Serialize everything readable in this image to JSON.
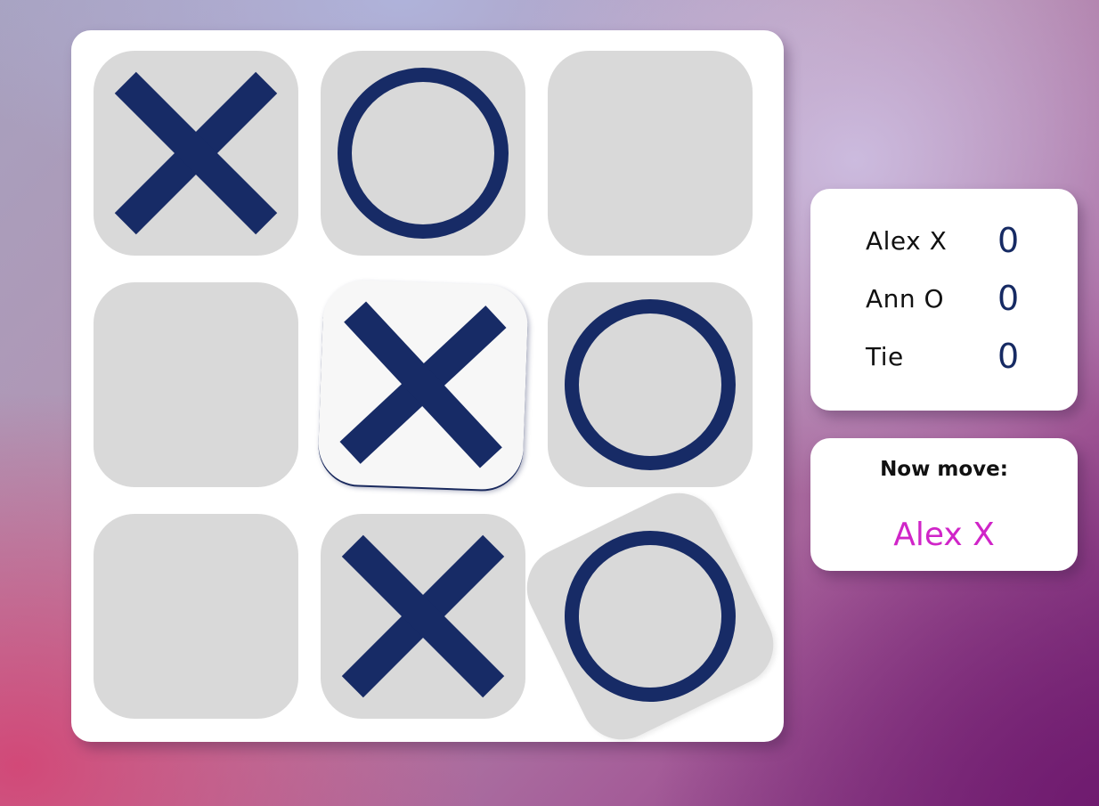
{
  "board": {
    "mark_color": "#172b66",
    "cells": [
      {
        "mark": "X"
      },
      {
        "mark": "O"
      },
      {
        "mark": ""
      },
      {
        "mark": ""
      },
      {
        "mark": "X"
      },
      {
        "mark": "O"
      },
      {
        "mark": ""
      },
      {
        "mark": "X"
      },
      {
        "mark": "O"
      }
    ]
  },
  "scoreboard": {
    "rows": [
      {
        "name": "Alex X",
        "score": "0"
      },
      {
        "name": "Ann O",
        "score": "0"
      },
      {
        "name": "Tie",
        "score": "0"
      }
    ]
  },
  "turn": {
    "label": "Now move:",
    "player": "Alex X",
    "player_color": "#d025c8"
  }
}
